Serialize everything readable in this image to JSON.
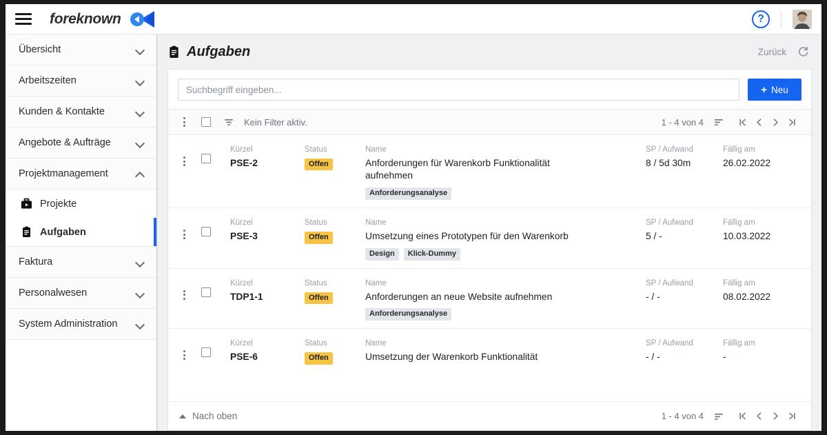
{
  "topbar": {
    "menu_icon": "hamburger-icon",
    "brand_name": "foreknown",
    "brand_logo_icon": "foreknown-logo-icon",
    "help_icon": "help-circle-icon",
    "help_glyph": "?",
    "avatar_icon": "user-avatar"
  },
  "sidebar": {
    "groups": [
      {
        "label": "Übersicht",
        "expanded": false
      },
      {
        "label": "Arbeitszeiten",
        "expanded": false
      },
      {
        "label": "Kunden & Kontakte",
        "expanded": false
      },
      {
        "label": "Angebote & Aufträge",
        "expanded": false
      },
      {
        "label": "Projektmanagement",
        "expanded": true
      },
      {
        "label": "Faktura",
        "expanded": false
      },
      {
        "label": "Personalwesen",
        "expanded": false
      },
      {
        "label": "System Administration",
        "expanded": false
      }
    ],
    "sub_items": [
      {
        "label": "Projekte",
        "icon": "briefcase-icon",
        "active": false
      },
      {
        "label": "Aufgaben",
        "icon": "clipboard-icon",
        "active": true
      }
    ]
  },
  "page": {
    "title": "Aufgaben",
    "title_icon": "clipboard-icon",
    "back_label": "Zurück",
    "refresh_icon": "refresh-icon"
  },
  "search": {
    "placeholder": "Suchbegriff eingeben...",
    "value": "",
    "new_button_label": "Neu",
    "new_button_plus": "+"
  },
  "toolbar": {
    "kebab_icon": "more-vertical-icon",
    "select_all_icon": "checkbox-icon",
    "filter_icon": "filter-icon",
    "filter_text": "Kein Filter aktiv.",
    "pager_count": "1 - 4 von 4",
    "sort_icon": "sort-icon",
    "nav": [
      {
        "icon": "first-page-icon",
        "label": "|<"
      },
      {
        "icon": "prev-page-icon",
        "label": "<"
      },
      {
        "icon": "next-page-icon",
        "label": ">"
      },
      {
        "icon": "last-page-icon",
        "label": ">|"
      }
    ]
  },
  "table": {
    "headers": {
      "kuerzel": "Kürzel",
      "status": "Status",
      "name": "Name",
      "sp": "SP / Aufwand",
      "due": "Fällig am"
    },
    "rows": [
      {
        "kuerzel": "PSE-2",
        "status": "Offen",
        "name": "Anforderungen für Warenkorb Funktionalität aufnehmen",
        "tags": [
          "Anforderungsanalyse"
        ],
        "sp": "8 / 5d 30m",
        "due": "26.02.2022"
      },
      {
        "kuerzel": "PSE-3",
        "status": "Offen",
        "name": "Umsetzung eines Prototypen für den Warenkorb",
        "tags": [
          "Design",
          "Klick-Dummy"
        ],
        "sp": "5 / -",
        "due": "10.03.2022"
      },
      {
        "kuerzel": "TDP1-1",
        "status": "Offen",
        "name": "Anforderungen an neue Website aufnehmen",
        "tags": [
          "Anforderungsanalyse"
        ],
        "sp": "- / -",
        "due": "08.02.2022"
      },
      {
        "kuerzel": "PSE-6",
        "status": "Offen",
        "name": "Umsetzung der Warenkorb Funktionalität",
        "tags": [],
        "sp": "- / -",
        "due": "-"
      }
    ]
  },
  "footer": {
    "to_top_label": "Nach oben",
    "to_top_icon": "caret-up-icon",
    "pager_count": "1 - 4 von 4",
    "sort_icon": "sort-icon",
    "nav": [
      {
        "icon": "first-page-icon",
        "label": "|<"
      },
      {
        "icon": "prev-page-icon",
        "label": "<"
      },
      {
        "icon": "next-page-icon",
        "label": ">"
      },
      {
        "icon": "last-page-icon",
        "label": ">|"
      }
    ]
  },
  "colors": {
    "accent": "#1565f0",
    "status_badge": "#f6c344",
    "tag_bg": "#e2e5ea",
    "page_bg": "#f0f1f3"
  }
}
